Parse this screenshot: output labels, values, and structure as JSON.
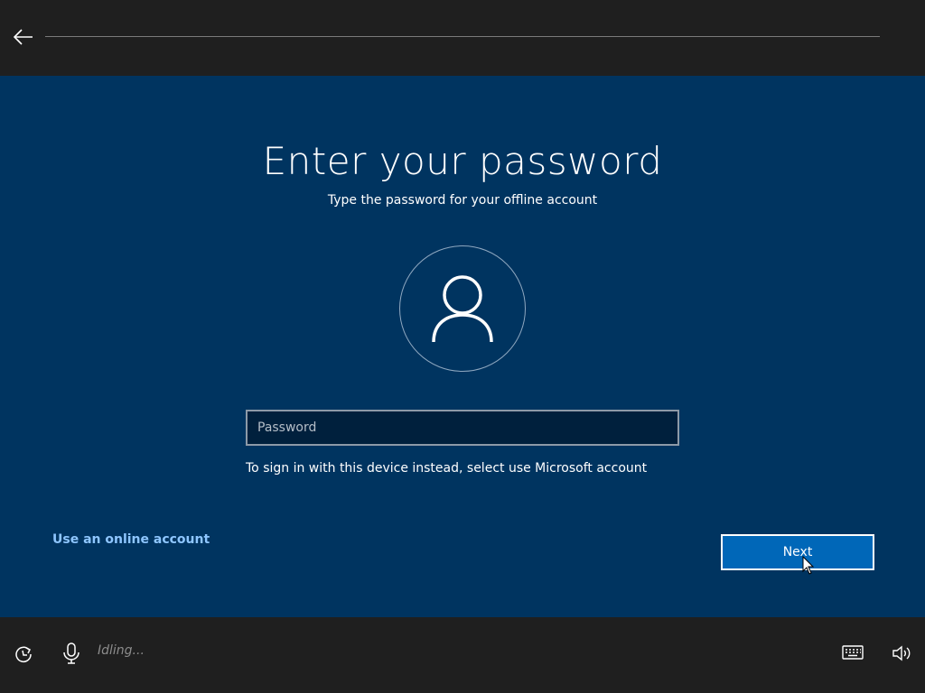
{
  "header": {
    "back_icon": "arrow-left-icon"
  },
  "main": {
    "title": "Enter your password",
    "subtitle": "Type the password for your offline account",
    "avatar_icon": "user-icon",
    "password": {
      "value": "",
      "placeholder": "Password"
    },
    "hint": "To sign in with this device instead, select use Microsoft account",
    "online_link": "Use an online account",
    "next_label": "Next"
  },
  "footer": {
    "ease_icon": "ease-of-access-icon",
    "mic_icon": "microphone-icon",
    "status": "Idling...",
    "keyboard_icon": "keyboard-icon",
    "volume_icon": "volume-icon"
  },
  "colors": {
    "bar_bg": "#1f1f1f",
    "main_bg": "#003460",
    "accent": "#0067b8",
    "link": "#8ec6ff"
  }
}
